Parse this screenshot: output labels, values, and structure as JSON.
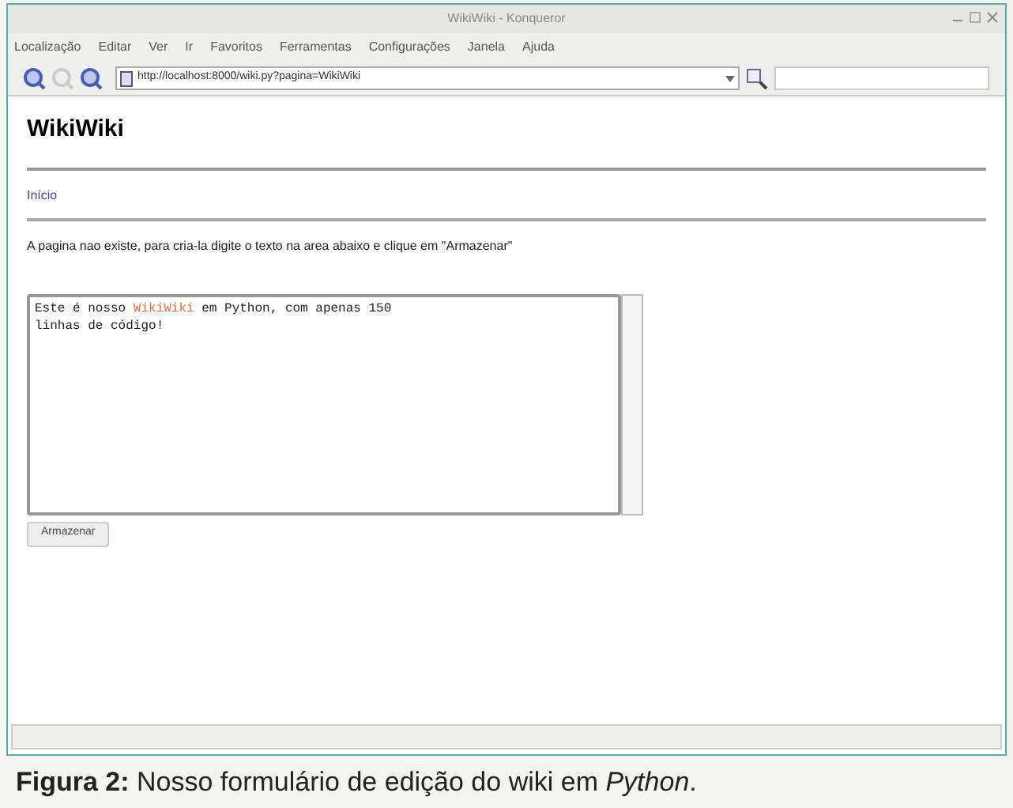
{
  "window": {
    "title": "WikiWiki - Konqueror"
  },
  "menu": [
    "Localização",
    "Editar",
    "Ver",
    "Ir",
    "Favoritos",
    "Ferramentas",
    "Configurações",
    "Janela",
    "Ajuda"
  ],
  "address_bar": {
    "value": "http://localhost:8000/wiki.py?pagina=WikiWiki"
  },
  "page": {
    "heading": "WikiWiki",
    "link": "Início",
    "message": "A pagina nao existe, para cria-la digite o texto na area abaixo e clique em \"Armazenar\"",
    "editor": {
      "segments": [
        {
          "text": "Este é nosso ",
          "highlighted": false
        },
        {
          "text": "WikiWiki",
          "highlighted": true
        },
        {
          "text": " em Python, com apenas 150\nlinhas de código!",
          "highlighted": false
        }
      ]
    },
    "button": "Armazenar"
  },
  "caption": "**Figura 2:** Nosso formulário de edição do wiki em *Python*."
}
